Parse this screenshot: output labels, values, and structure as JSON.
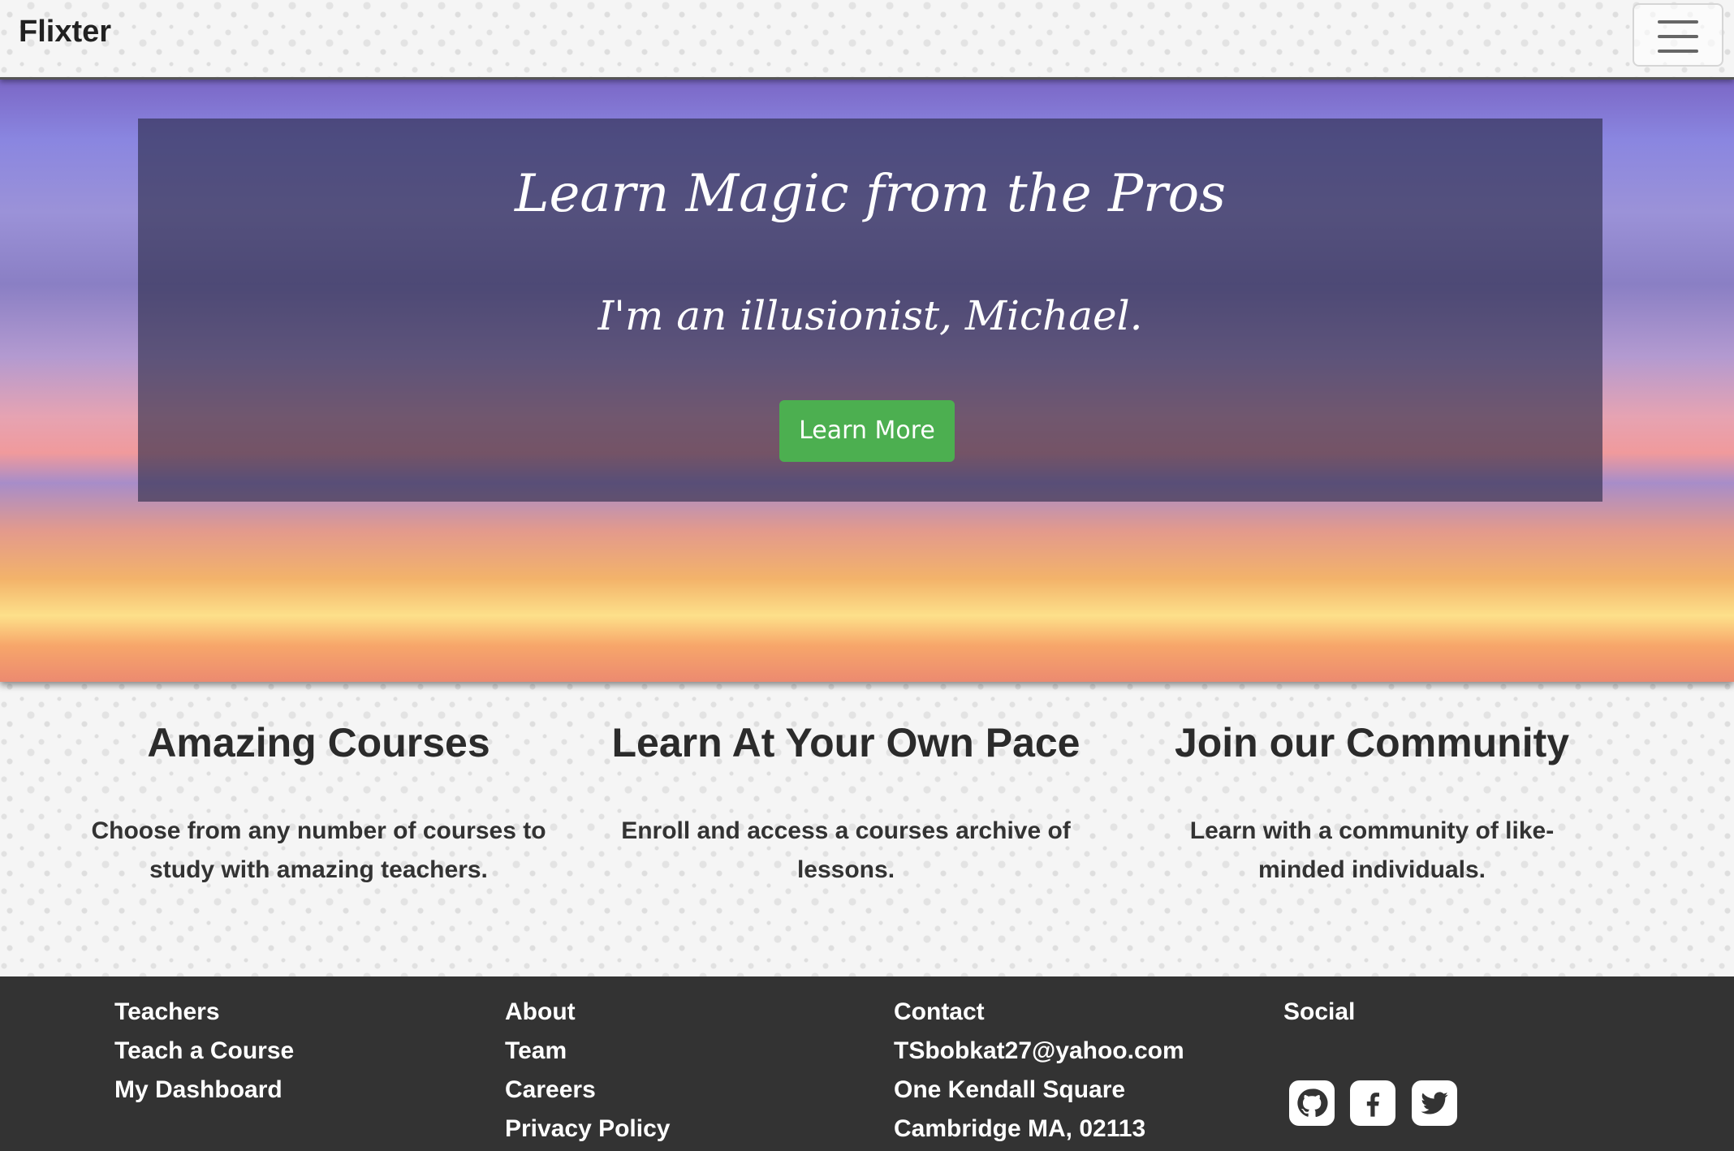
{
  "navbar": {
    "brand": "Flixter",
    "menu_icon": "hamburger-menu-icon"
  },
  "hero": {
    "title": "Learn Magic from the Pros",
    "subtitle": "I'm an illusionist, Michael.",
    "button_label": "Learn More",
    "button_color": "#4caf50"
  },
  "features": [
    {
      "title": "Amazing Courses",
      "text": "Choose from any number of courses to study with amazing teachers."
    },
    {
      "title": "Learn At Your Own Pace",
      "text": "Enroll and access a courses archive of lessons."
    },
    {
      "title": "Join our Community",
      "text": "Learn with a community of like-minded individuals."
    }
  ],
  "footer": {
    "teachers": {
      "heading": "Teachers",
      "items": [
        "Teach a Course",
        "My Dashboard"
      ]
    },
    "about": {
      "heading": "About",
      "items": [
        "Team",
        "Careers",
        "Privacy Policy"
      ]
    },
    "contact": {
      "heading": "Contact",
      "items": [
        "TSbobkat27@yahoo.com",
        "One Kendall Square",
        "Cambridge MA, 02113"
      ]
    },
    "social": {
      "heading": "Social",
      "icons": [
        "github-icon",
        "facebook-icon",
        "twitter-icon"
      ]
    }
  },
  "colors": {
    "footer_bg": "#333333",
    "page_bg": "#f5f5f5"
  }
}
